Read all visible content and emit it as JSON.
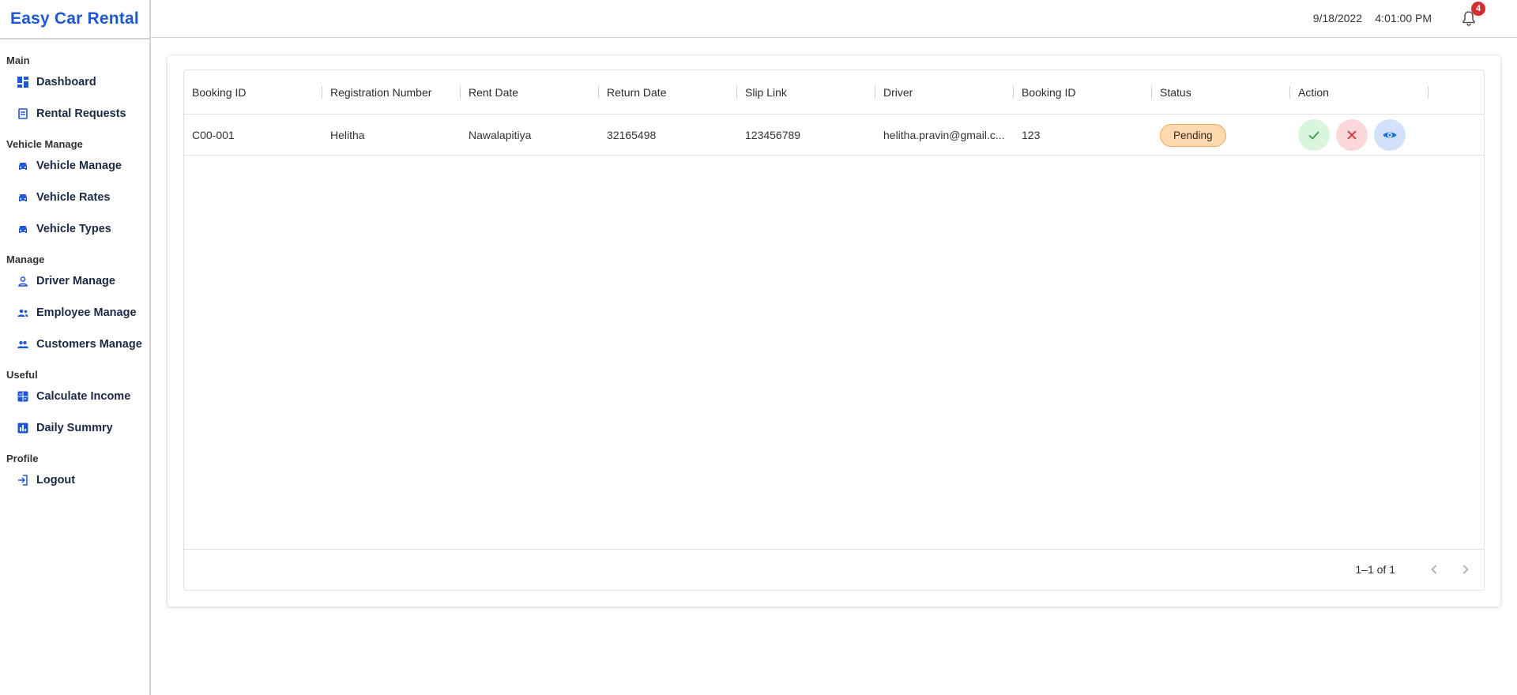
{
  "app": {
    "title": "Easy Car Rental"
  },
  "sidebar": {
    "sections": [
      {
        "title": "Main",
        "items": [
          {
            "label": "Dashboard",
            "icon": "dashboard-icon"
          },
          {
            "label": "Rental Requests",
            "icon": "request-icon"
          }
        ]
      },
      {
        "title": "Vehicle Manage",
        "items": [
          {
            "label": "Vehicle Manage",
            "icon": "car-icon"
          },
          {
            "label": "Vehicle Rates",
            "icon": "car-icon"
          },
          {
            "label": "Vehicle Types",
            "icon": "car-icon"
          }
        ]
      },
      {
        "title": "Manage",
        "items": [
          {
            "label": "Driver Manage",
            "icon": "person-icon"
          },
          {
            "label": "Employee Manage",
            "icon": "people-icon"
          },
          {
            "label": "Customers Manage",
            "icon": "group-icon"
          }
        ]
      },
      {
        "title": "Useful",
        "items": [
          {
            "label": "Calculate Income",
            "icon": "calculator-icon"
          },
          {
            "label": "Daily Summry",
            "icon": "bar-chart-icon"
          }
        ]
      },
      {
        "title": "Profile",
        "items": [
          {
            "label": "Logout",
            "icon": "logout-icon"
          }
        ]
      }
    ]
  },
  "header": {
    "date": "9/18/2022",
    "time": "4:01:00 PM",
    "notification_count": "4"
  },
  "table": {
    "columns": [
      "Booking ID",
      "Registration Number",
      "Rent Date",
      "Return Date",
      "Slip Link",
      "Driver",
      "Booking ID",
      "Status",
      "Action"
    ],
    "rows": [
      {
        "booking_id": "C00-001",
        "registration": "Helitha",
        "rent_date": "Nawalapitiya",
        "return_date": "32165498",
        "slip_link": "123456789",
        "driver": "helitha.pravin@gmail.c...",
        "booking_id_2": "123",
        "status": "Pending"
      }
    ],
    "pagination": "1–1 of 1"
  },
  "colors": {
    "accent": "#1e56d6",
    "badge": "#d32f2f",
    "pending_bg": "#ffd9b0"
  }
}
